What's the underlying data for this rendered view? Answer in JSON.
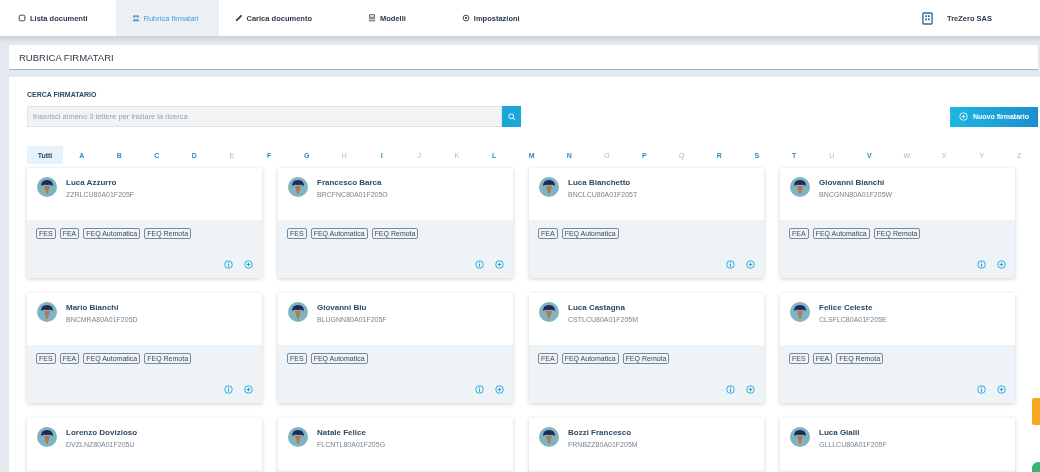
{
  "nav": {
    "tabs": [
      {
        "label": "Lista documenti",
        "selected": false
      },
      {
        "label": "Rubrica firmatari",
        "selected": true
      },
      {
        "label": "Carica documento",
        "selected": false
      },
      {
        "label": "Modelli",
        "selected": false
      },
      {
        "label": "Impostazioni",
        "selected": false
      }
    ],
    "company": "TreZero SAS"
  },
  "page_title": "RUBRICA FIRMATARI",
  "search": {
    "label": "CERCA FIRMATARIO",
    "placeholder": "Inserisci almeno 3 lettere per iniziare la ricerca"
  },
  "new_button": "Nuovo firmatario",
  "letters": [
    {
      "label": "Tutti",
      "selected": true,
      "disabled": false
    },
    {
      "label": "A",
      "selected": false,
      "disabled": false
    },
    {
      "label": "B",
      "selected": false,
      "disabled": false
    },
    {
      "label": "C",
      "selected": false,
      "disabled": false
    },
    {
      "label": "D",
      "selected": false,
      "disabled": false
    },
    {
      "label": "E",
      "selected": false,
      "disabled": true
    },
    {
      "label": "F",
      "selected": false,
      "disabled": false
    },
    {
      "label": "G",
      "selected": false,
      "disabled": false
    },
    {
      "label": "H",
      "selected": false,
      "disabled": true
    },
    {
      "label": "I",
      "selected": false,
      "disabled": false
    },
    {
      "label": "J",
      "selected": false,
      "disabled": true
    },
    {
      "label": "K",
      "selected": false,
      "disabled": true
    },
    {
      "label": "L",
      "selected": false,
      "disabled": false
    },
    {
      "label": "M",
      "selected": false,
      "disabled": false
    },
    {
      "label": "N",
      "selected": false,
      "disabled": false
    },
    {
      "label": "O",
      "selected": false,
      "disabled": true
    },
    {
      "label": "P",
      "selected": false,
      "disabled": false
    },
    {
      "label": "Q",
      "selected": false,
      "disabled": true
    },
    {
      "label": "R",
      "selected": false,
      "disabled": false
    },
    {
      "label": "S",
      "selected": false,
      "disabled": false
    },
    {
      "label": "T",
      "selected": false,
      "disabled": false
    },
    {
      "label": "U",
      "selected": false,
      "disabled": true
    },
    {
      "label": "V",
      "selected": false,
      "disabled": false
    },
    {
      "label": "W",
      "selected": false,
      "disabled": true
    },
    {
      "label": "X",
      "selected": false,
      "disabled": true
    },
    {
      "label": "Y",
      "selected": false,
      "disabled": true
    },
    {
      "label": "Z",
      "selected": false,
      "disabled": true
    }
  ],
  "signers": [
    {
      "name": "Luca Azzurro",
      "code": "ZZRLCU80A01F205F",
      "tags": [
        "FES",
        "FEA",
        "FEQ Automatica",
        "FEQ Remota"
      ]
    },
    {
      "name": "Francesco Barca",
      "code": "BRCFNC80A01F205O",
      "tags": [
        "FES",
        "FEQ Automatica",
        "FEQ Remota"
      ]
    },
    {
      "name": "Luca Bianchetto",
      "code": "BNCLCU80A01F205T",
      "tags": [
        "FEA",
        "FEQ Automatica"
      ]
    },
    {
      "name": "Giovanni Bianchi",
      "code": "BNCGNN80A01F205W",
      "tags": [
        "FEA",
        "FEQ Automatica",
        "FEQ Remota"
      ]
    },
    {
      "name": "Mario Bianchi",
      "code": "BNCMRA80A01F205D",
      "tags": [
        "FES",
        "FEA",
        "FEQ Automatica",
        "FEQ Remota"
      ]
    },
    {
      "name": "Giovanni Blu",
      "code": "BLUGNN80A01F205F",
      "tags": [
        "FES",
        "FEQ Automatica"
      ]
    },
    {
      "name": "Luca Castagna",
      "code": "CSTLCU80A01F205M",
      "tags": [
        "FEA",
        "FEQ Automatica",
        "FEQ Remota"
      ]
    },
    {
      "name": "Felice Celeste",
      "code": "CLSFLC80A01F205E",
      "tags": [
        "FES",
        "FEA",
        "FEQ Remota"
      ]
    },
    {
      "name": "Lorenzo Dovizioso",
      "code": "DVZLNZ80A01F205U"
    },
    {
      "name": "Natale Felice",
      "code": "FLCNTL80A01F205G"
    },
    {
      "name": "Bozzi Francesco",
      "code": "FRNBZZ80A01F205M"
    },
    {
      "name": "Luca Gialli",
      "code": "GLLLCU80A01F205F"
    }
  ]
}
